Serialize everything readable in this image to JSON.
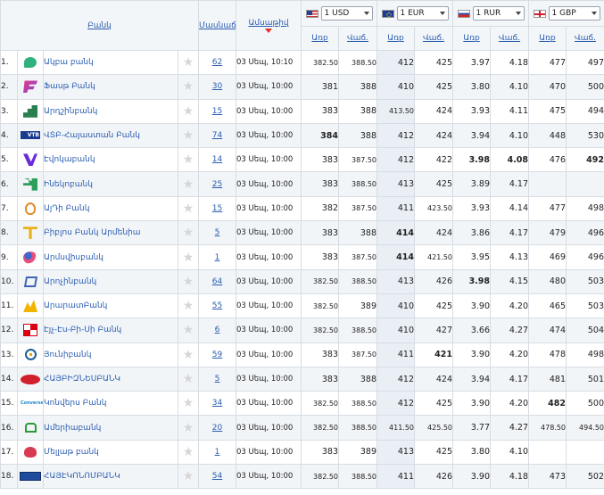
{
  "header": {
    "bank_col": "Բանկ",
    "branches_col": "Մասնաճյուղեր",
    "updated_col": "Ամսաթիվ",
    "buy_label": "Առք",
    "sell_label": "Վաճ.",
    "currencies": [
      {
        "code": "usd",
        "selected": "1 USD"
      },
      {
        "code": "eur",
        "selected": "1 EUR"
      },
      {
        "code": "rur",
        "selected": "1 RUR"
      },
      {
        "code": "gbp",
        "selected": "1 GBP"
      }
    ]
  },
  "rows": [
    {
      "idx": "1.",
      "logo": "acba-logo",
      "name": "Ակբա բանկ",
      "branches": "62",
      "date": "03 Սեպ, 10:10",
      "usd_buy": "382.50",
      "usd_sell": "388.50",
      "eur_buy": "412",
      "eur_sell": "425",
      "rur_buy": "3.97",
      "rur_sell": "4.18",
      "gbp_buy": "477",
      "gbp_sell": "497"
    },
    {
      "idx": "2.",
      "logo": "fast-logo",
      "name": "Ֆասթ Բանկ",
      "branches": "30",
      "date": "03 Սեպ, 10:00",
      "usd_buy": "381",
      "usd_sell": "388",
      "eur_buy": "410",
      "eur_sell": "425",
      "rur_buy": "3.80",
      "rur_sell": "4.10",
      "gbp_buy": "470",
      "gbp_sell": "500"
    },
    {
      "idx": "3.",
      "logo": "ardshin-logo",
      "name": "Արդշինբանկ",
      "branches": "15",
      "date": "03 Սեպ, 10:00",
      "usd_buy": "383",
      "usd_sell": "388",
      "eur_buy": "413.50",
      "eur_sell": "424",
      "rur_buy": "3.93",
      "rur_sell": "4.11",
      "gbp_buy": "475",
      "gbp_sell": "494"
    },
    {
      "idx": "4.",
      "logo": "vtb-logo",
      "name": "ՎՏԲ-Հայաստան Բանկ",
      "branches": "74",
      "date": "03 Սեպ, 10:00",
      "usd_buy": "384",
      "usd_sell": "388",
      "eur_buy": "412",
      "eur_sell": "424",
      "rur_buy": "3.94",
      "rur_sell": "4.10",
      "gbp_buy": "448",
      "gbp_sell": "530",
      "logo_text": "VTB"
    },
    {
      "idx": "5.",
      "logo": "evoca-logo",
      "name": "Էվոկաբանկ",
      "branches": "14",
      "date": "03 Սեպ, 10:00",
      "usd_buy": "383",
      "usd_sell": "387.50",
      "eur_buy": "412",
      "eur_sell": "422",
      "rur_buy": "3.98",
      "rur_sell": "4.08",
      "gbp_buy": "476",
      "gbp_sell": "492"
    },
    {
      "idx": "6.",
      "logo": "ineco-logo",
      "name": "Ինեկոբանկ",
      "branches": "25",
      "date": "03 Սեպ, 10:00",
      "usd_buy": "383",
      "usd_sell": "388.50",
      "eur_buy": "413",
      "eur_sell": "425",
      "rur_buy": "3.89",
      "rur_sell": "4.17",
      "gbp_buy": "",
      "gbp_sell": ""
    },
    {
      "idx": "7.",
      "logo": "aeb-logo",
      "name": "ԱյԴի Բանկ",
      "branches": "15",
      "date": "03 Սեպ, 10:00",
      "usd_buy": "382",
      "usd_sell": "387.50",
      "eur_buy": "411",
      "eur_sell": "423.50",
      "rur_buy": "3.93",
      "rur_sell": "4.14",
      "gbp_buy": "477",
      "gbp_sell": "498"
    },
    {
      "idx": "8.",
      "logo": "byblos-logo",
      "name": "Բիբլոս Բանկ Արմենիա",
      "branches": "5",
      "date": "03 Սեպ, 10:00",
      "usd_buy": "383",
      "usd_sell": "388",
      "eur_buy": "414",
      "eur_sell": "424",
      "rur_buy": "3.86",
      "rur_sell": "4.17",
      "gbp_buy": "479",
      "gbp_sell": "496"
    },
    {
      "idx": "9.",
      "logo": "armswiss-logo",
      "name": "Արմսվիսբանկ",
      "branches": "1",
      "date": "03 Սեպ, 10:00",
      "usd_buy": "383",
      "usd_sell": "387.50",
      "eur_buy": "414",
      "eur_sell": "421.50",
      "rur_buy": "3.95",
      "rur_sell": "4.13",
      "gbp_buy": "469",
      "gbp_sell": "496"
    },
    {
      "idx": "10.",
      "logo": "converse-logo",
      "name": "Արոչինբանկ",
      "branches": "64",
      "date": "03 Սեպ, 10:00",
      "usd_buy": "382.50",
      "usd_sell": "388.50",
      "eur_buy": "413",
      "eur_sell": "426",
      "rur_buy": "3.98",
      "rur_sell": "4.15",
      "gbp_buy": "480",
      "gbp_sell": "503"
    },
    {
      "idx": "11.",
      "logo": "ararat-logo",
      "name": "ԱրարատԲանկ",
      "branches": "55",
      "date": "03 Սեպ, 10:00",
      "usd_buy": "382.50",
      "usd_sell": "389",
      "eur_buy": "410",
      "eur_sell": "425",
      "rur_buy": "3.90",
      "rur_sell": "4.20",
      "gbp_buy": "465",
      "gbp_sell": "503"
    },
    {
      "idx": "12.",
      "logo": "hsbc-logo",
      "name": "Էյչ-Էս-Բի-Սի Բանկ",
      "branches": "6",
      "date": "03 Սեպ, 10:00",
      "usd_buy": "382.50",
      "usd_sell": "388.50",
      "eur_buy": "410",
      "eur_sell": "427",
      "rur_buy": "3.66",
      "rur_sell": "4.27",
      "gbp_buy": "474",
      "gbp_sell": "504"
    },
    {
      "idx": "13.",
      "logo": "unibank-logo",
      "name": "Յունիբանկ",
      "branches": "59",
      "date": "03 Սեպ, 10:00",
      "usd_buy": "383",
      "usd_sell": "387.50",
      "eur_buy": "411",
      "eur_sell": "421",
      "rur_buy": "3.90",
      "rur_sell": "4.20",
      "gbp_buy": "478",
      "gbp_sell": "498"
    },
    {
      "idx": "14.",
      "logo": "haybiznes-logo",
      "name": "ՀԱՅԲԻԶՆԵՍԲԱՆԿ",
      "branches": "5",
      "date": "03 Սեպ, 10:00",
      "usd_buy": "383",
      "usd_sell": "388",
      "eur_buy": "412",
      "eur_sell": "424",
      "rur_buy": "3.94",
      "rur_sell": "4.17",
      "gbp_buy": "481",
      "gbp_sell": "501"
    },
    {
      "idx": "15.",
      "logo": "conversbank-logo",
      "name": "Կոնվերս Բանկ",
      "branches": "34",
      "date": "03 Սեպ, 10:00",
      "usd_buy": "382.50",
      "usd_sell": "388.50",
      "eur_buy": "412",
      "eur_sell": "425",
      "rur_buy": "3.90",
      "rur_sell": "4.20",
      "gbp_buy": "482",
      "gbp_sell": "500",
      "logo_text": "ConverseBank"
    },
    {
      "idx": "16.",
      "logo": "ameria-logo",
      "name": "Ամերիաբանկ",
      "branches": "20",
      "date": "03 Սեպ, 10:00",
      "usd_buy": "382.50",
      "usd_sell": "388.50",
      "eur_buy": "411.50",
      "eur_sell": "425.50",
      "rur_buy": "3.77",
      "rur_sell": "4.27",
      "gbp_buy": "478.50",
      "gbp_sell": "494.50"
    },
    {
      "idx": "17.",
      "logo": "mellat-logo",
      "name": "Մելլաթ բանկ",
      "branches": "1",
      "date": "03 Սեպ, 10:00",
      "usd_buy": "383",
      "usd_sell": "389",
      "eur_buy": "413",
      "eur_sell": "425",
      "rur_buy": "3.80",
      "rur_sell": "4.10",
      "gbp_buy": "",
      "gbp_sell": ""
    },
    {
      "idx": "18.",
      "logo": "heb-logo",
      "name": "ՀԱՅԷԿՈՆՈՄԲԱՆԿ",
      "branches": "54",
      "date": "03 Սեպ, 10:00",
      "usd_buy": "382.50",
      "usd_sell": "388.50",
      "eur_buy": "411",
      "eur_sell": "426",
      "rur_buy": "3.90",
      "rur_sell": "4.18",
      "gbp_buy": "473",
      "gbp_sell": "502"
    }
  ],
  "bold_cells": [
    [
      3,
      "usd_buy"
    ],
    [
      4,
      "rur_buy"
    ],
    [
      4,
      "rur_sell"
    ],
    [
      4,
      "gbp_sell"
    ],
    [
      7,
      "eur_buy"
    ],
    [
      8,
      "eur_buy"
    ],
    [
      9,
      "rur_buy"
    ],
    [
      12,
      "eur_sell"
    ],
    [
      14,
      "gbp_buy"
    ]
  ],
  "colors": {
    "link": "#2a5db0",
    "row_alt": "#f2f5f8",
    "border": "#d7dde3",
    "sort_arrow": "#e0302a"
  }
}
